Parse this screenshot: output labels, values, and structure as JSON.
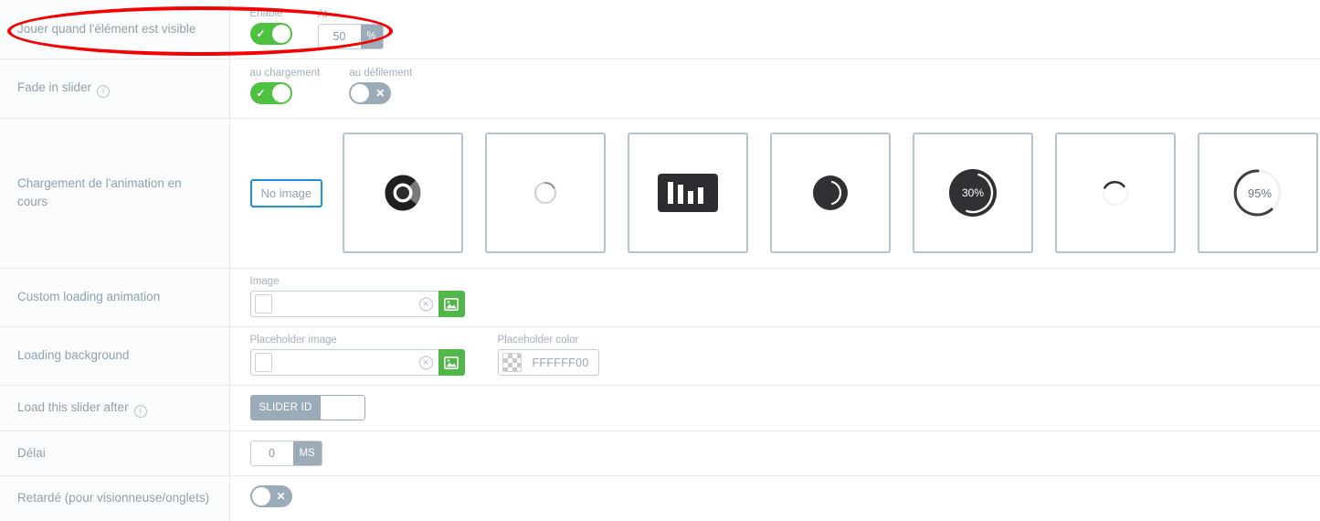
{
  "rows": {
    "play_when_visible": {
      "label": "Jouer quand l'élément est visible",
      "enable_caption": "Enable",
      "enable_state": "on",
      "at_caption": "At",
      "at_value": "50",
      "at_unit": "%"
    },
    "fade_in_slider": {
      "label": "Fade in slider",
      "has_info": true,
      "on_load_caption": "au chargement",
      "on_load_state": "on",
      "on_scroll_caption": "au défilement",
      "on_scroll_state": "off"
    },
    "loading_animation": {
      "label": "Chargement de l'animation en cours",
      "no_image_label": "No image",
      "options": [
        {
          "name": "ring-dark-spinner",
          "percent": ""
        },
        {
          "name": "thin-circle-spinner",
          "percent": ""
        },
        {
          "name": "bars-spinner",
          "percent": ""
        },
        {
          "name": "moon-spinner",
          "percent": ""
        },
        {
          "name": "percent-disc-spinner",
          "percent": "30%"
        },
        {
          "name": "arc-spinner",
          "percent": ""
        },
        {
          "name": "percent-ring-spinner",
          "percent": "95%"
        }
      ]
    },
    "custom_loading_animation": {
      "label": "Custom loading animation",
      "image_caption": "Image",
      "image_value": "",
      "clear_icon": "clear-icon",
      "browse_icon": "image-browse-icon"
    },
    "loading_background": {
      "label": "Loading background",
      "placeholder_image_caption": "Placeholder image",
      "placeholder_image_value": "",
      "placeholder_color_caption": "Placeholder color",
      "placeholder_color_value": "FFFFFF00"
    },
    "load_after": {
      "label": "Load this slider after",
      "has_info": true,
      "prefix": "SLIDER ID",
      "value": ""
    },
    "delay": {
      "label": "Délai",
      "value": "0",
      "unit": "MS"
    },
    "deferred": {
      "label": "Retardé (pour visionneuse/onglets)",
      "state": "off"
    }
  },
  "colors": {
    "toggle_on": "#4fc140",
    "toggle_off": "#9bacb8",
    "browse_green": "#52b749",
    "highlight_red": "#f50000",
    "focus_blue": "#1e93dd",
    "label_text": "#90a0ad"
  },
  "annotation": {
    "highlight_shape": "ellipse",
    "highlight_target": "Jouer quand l'élément est visible"
  }
}
